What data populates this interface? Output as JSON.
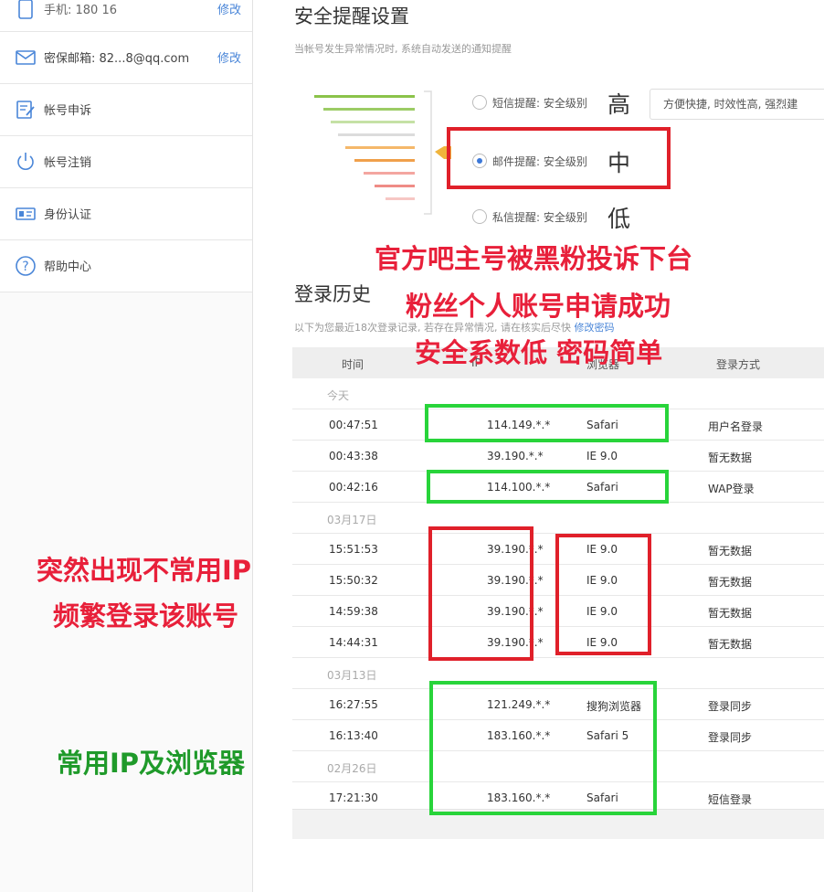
{
  "sidebar": {
    "phone_label": "手机: 180      16",
    "phone_link": "修改",
    "email_label": "密保邮箱: 82...8@qq.com",
    "email_link": "修改",
    "items": [
      {
        "label": "帐号申诉",
        "icon": "appeal-icon"
      },
      {
        "label": "帐号注销",
        "icon": "power-icon"
      },
      {
        "label": "身份认证",
        "icon": "id-card-icon"
      },
      {
        "label": "帮助中心",
        "icon": "help-icon"
      }
    ]
  },
  "security_alert": {
    "title": "安全提醒设置",
    "subtitle": "当帐号发生异常情况时, 系统自动发送的通知提醒",
    "options": [
      {
        "label": "短信提醒: 安全级别",
        "level": "高",
        "selected": false
      },
      {
        "label": "邮件提醒: 安全级别",
        "level": "中",
        "selected": true
      },
      {
        "label": "私信提醒: 安全级别",
        "level": "低",
        "selected": false
      }
    ],
    "tooltip": "方便快捷, 时效性高, 强烈建"
  },
  "login_history": {
    "title": "登录历史",
    "subtitle": "以下为您最近18次登录记录, 若存在异常情况, 请在核实后尽快",
    "subtitle_link": "修改密码",
    "columns": [
      "时间",
      "IP",
      "浏览器",
      "登录方式"
    ],
    "groups": [
      {
        "date": "今天",
        "rows": [
          {
            "time": "00:47:51",
            "ip": "114.149.*.*",
            "browser": "Safari",
            "method": "用户名登录"
          },
          {
            "time": "00:43:38",
            "ip": "39.190.*.*",
            "browser": "IE 9.0",
            "method": "暂无数据"
          },
          {
            "time": "00:42:16",
            "ip": "114.100.*.*",
            "browser": "Safari",
            "method": "WAP登录"
          }
        ]
      },
      {
        "date": "03月17日",
        "rows": [
          {
            "time": "15:51:53",
            "ip": "39.190.*.*",
            "browser": "IE 9.0",
            "method": "暂无数据"
          },
          {
            "time": "15:50:32",
            "ip": "39.190.*.*",
            "browser": "IE 9.0",
            "method": "暂无数据"
          },
          {
            "time": "14:59:38",
            "ip": "39.190.*.*",
            "browser": "IE 9.0",
            "method": "暂无数据"
          },
          {
            "time": "14:44:31",
            "ip": "39.190.*.*",
            "browser": "IE 9.0",
            "method": "暂无数据"
          }
        ]
      },
      {
        "date": "03月13日",
        "rows": [
          {
            "time": "16:27:55",
            "ip": "121.249.*.*",
            "browser": "搜狗浏览器",
            "method": "登录同步"
          },
          {
            "time": "16:13:40",
            "ip": "183.160.*.*",
            "browser": "Safari 5",
            "method": "登录同步"
          }
        ]
      },
      {
        "date": "02月26日",
        "rows": [
          {
            "time": "17:21:30",
            "ip": "183.160.*.*",
            "browser": "Safari",
            "method": "短信登录"
          }
        ]
      }
    ]
  },
  "annotations": {
    "top_lines": [
      "官方吧主号被黑粉投诉下台",
      "粉丝个人账号申请成功",
      "安全系数低 密码简单"
    ],
    "left_lines": [
      "突然出现不常用IP",
      "频繁登录该账号"
    ],
    "bottom": "常用IP及浏览器"
  },
  "colors": {
    "annotation_red": "#e0202a",
    "annotation_green": "#28d43a",
    "link_blue": "#4a86d8",
    "pyramid": [
      "#8bc34a",
      "#9ccc65",
      "#c5e1a5",
      "#dcdcdc",
      "#f5b86a",
      "#f0a04b",
      "#f4a6a0",
      "#ef8c86",
      "#f6c7c4"
    ]
  }
}
